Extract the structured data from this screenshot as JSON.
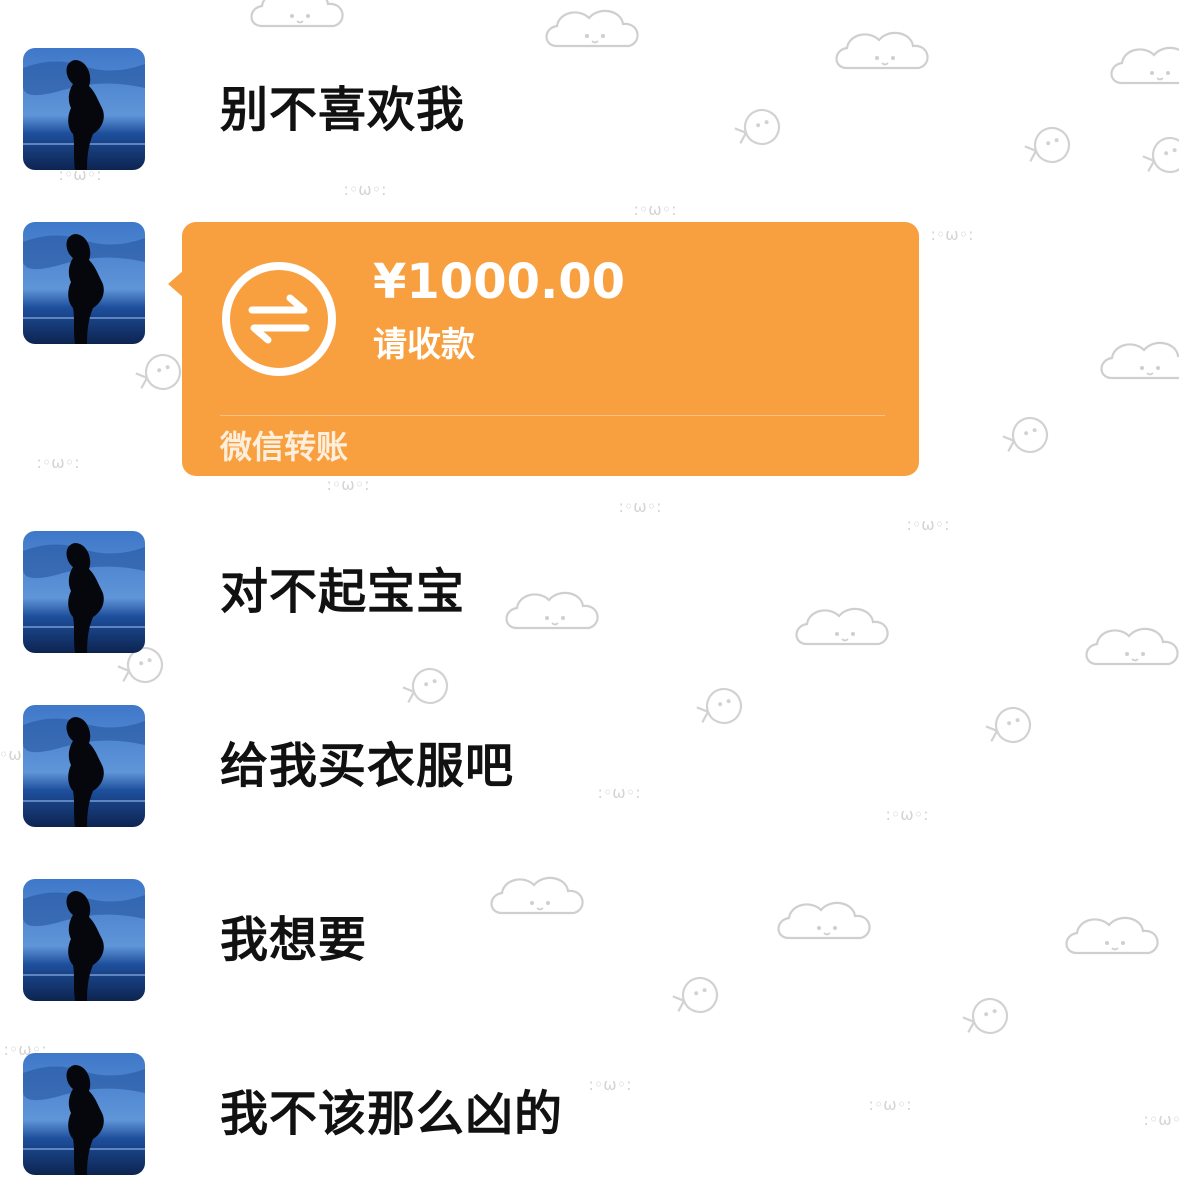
{
  "theme": {
    "transfer_color": "#f8a040",
    "text_color": "#111111",
    "background": "#ffffff"
  },
  "messages": [
    {
      "type": "text",
      "text": "别不喜欢我"
    },
    {
      "type": "transfer",
      "amount": "¥1000.00",
      "note": "请收款",
      "footer": "微信转账",
      "icon": "transfer-arrows-icon"
    },
    {
      "type": "text",
      "text": "对不起宝宝"
    },
    {
      "type": "text",
      "text": "给我买衣服吧"
    },
    {
      "type": "text",
      "text": "我想要"
    },
    {
      "type": "text",
      "text": "我不该那么凶的"
    }
  ]
}
